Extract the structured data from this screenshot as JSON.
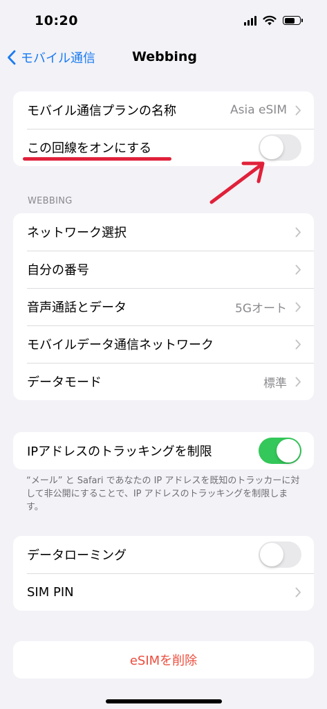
{
  "status_bar": {
    "time": "10:20",
    "battery_level": 0.65
  },
  "nav": {
    "back_label": "モバイル通信",
    "title": "Webbing"
  },
  "group1": {
    "plan_name_label": "モバイル通信プランの名称",
    "plan_name_value": "Asia eSIM",
    "turn_on_label": "この回線をオンにする",
    "turn_on_state": false
  },
  "webbing_header": "WEBBING",
  "group2": {
    "network_select": "ネットワーク選択",
    "my_number": "自分の番号",
    "voice_data_label": "音声通話とデータ",
    "voice_data_value": "5Gオート",
    "mobile_data_network": "モバイルデータ通信ネットワーク",
    "data_mode_label": "データモード",
    "data_mode_value": "標準"
  },
  "group3": {
    "limit_ip_tracking_label": "IPアドレスのトラッキングを制限",
    "limit_ip_tracking_state": true,
    "footnote": "“メール” と Safari であなたの IP アドレスを既知のトラッカーに対して非公開にすることで、IP アドレスのトラッキングを制限します。"
  },
  "group4": {
    "data_roaming_label": "データローミング",
    "data_roaming_state": false,
    "sim_pin_label": "SIM PIN"
  },
  "delete_esim_label": "eSIMを削除",
  "colors": {
    "accent": "#1a7bf2",
    "toggle_on": "#34c759",
    "destructive": "#eb4d3d",
    "annotation": "#e0213a"
  }
}
